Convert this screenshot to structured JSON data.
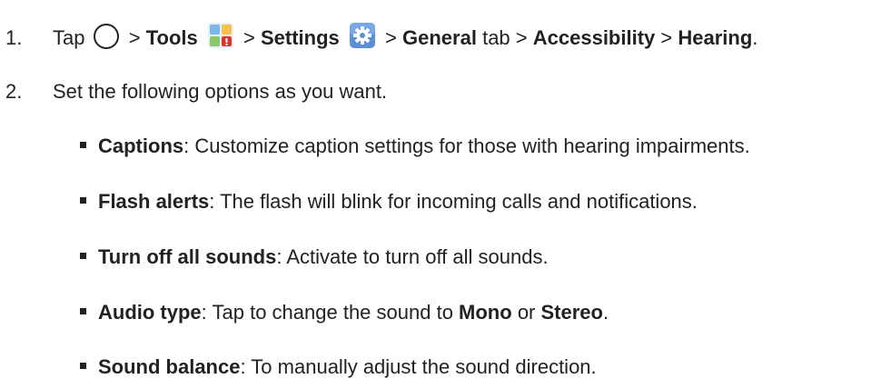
{
  "step1": {
    "number": "1.",
    "tap": "Tap",
    "sep1": ">",
    "tools": "Tools",
    "sep2": ">",
    "settings": "Settings",
    "sep3": ">",
    "general": "General",
    "tab_word": "tab >",
    "accessibility": "Accessibility",
    "sep4": ">",
    "hearing": "Hearing",
    "period": "."
  },
  "step2": {
    "number": "2.",
    "text": "Set the following options as you want."
  },
  "options": [
    {
      "label": "Captions",
      "desc": ": Customize caption settings for those with hearing impairments."
    },
    {
      "label": "Flash alerts",
      "desc": ": The flash will blink for incoming calls and notifications."
    },
    {
      "label": "Turn off all sounds",
      "desc": ": Activate to turn off all sounds."
    },
    {
      "label": "Audio type",
      "desc": ": Tap to change the sound to ",
      "mono": "Mono",
      "or": " or ",
      "stereo": "Stereo",
      "end": "."
    },
    {
      "label": "Sound balance",
      "desc": ": To manually adjust the sound direction."
    }
  ],
  "icons": {
    "home": "home-circle-icon",
    "tools": "tools-folder-icon",
    "settings": "settings-gear-icon"
  },
  "colors": {
    "text": "#222222",
    "settings_icon_bg": "#5b8fd6",
    "tools_icon_red": "#d9342b"
  }
}
